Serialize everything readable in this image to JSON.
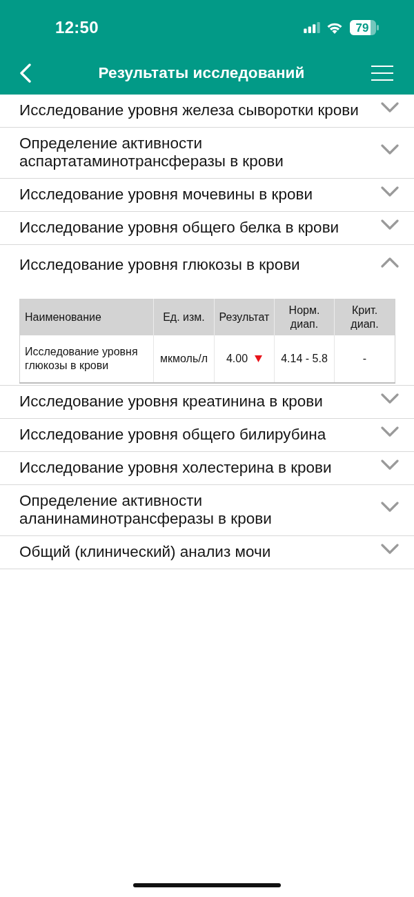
{
  "status_bar": {
    "time": "12:50",
    "battery": "79"
  },
  "header": {
    "title": "Результаты исследований"
  },
  "results": [
    {
      "title": "Исследование уровня железа сыворотки крови",
      "expanded": false
    },
    {
      "title": "Определение активности аспартатаминотрансферазы в крови",
      "expanded": false
    },
    {
      "title": "Исследование уровня мочевины в крови",
      "expanded": false
    },
    {
      "title": "Исследование уровня общего белка в крови",
      "expanded": false
    },
    {
      "title": "Исследование уровня глюкозы в крови",
      "expanded": true,
      "table": {
        "columns": [
          "Наименование",
          "Ед. изм.",
          "Результат",
          "Норм. диап.",
          "Крит. диап."
        ],
        "rows": [
          {
            "name": "Исследование уровня глюкозы в крови",
            "unit": "мкмоль/л",
            "result": "4.00",
            "below_range": true,
            "normal_range": "4.14 - 5.8",
            "critical_range": "-"
          }
        ]
      }
    },
    {
      "title": "Исследование уровня креатинина в крови",
      "expanded": false
    },
    {
      "title": "Исследование уровня общего билирубина",
      "expanded": false
    },
    {
      "title": "Исследование уровня холестерина в крови",
      "expanded": false
    },
    {
      "title": "Определение активности аланинаминотрансферазы в крови",
      "expanded": false
    },
    {
      "title": "Общий (клинический) анализ мочи",
      "expanded": false
    }
  ]
}
